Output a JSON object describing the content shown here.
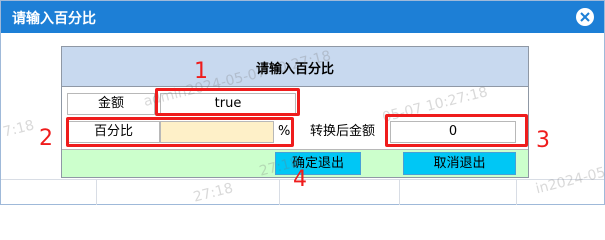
{
  "window": {
    "title": "请输入百分比"
  },
  "panel": {
    "title": "请输入百分比",
    "amount_label": "金额",
    "amount_value": "true",
    "percent_label": "百分比",
    "percent_value": "",
    "percent_unit": "%",
    "converted_label": "转换后金额",
    "converted_value": "0"
  },
  "buttons": {
    "confirm": "确定退出",
    "cancel": "取消退出"
  },
  "annotations": {
    "m1": "1",
    "m2": "2",
    "m3": "3",
    "m4": "4"
  },
  "watermark": {
    "w1": "admin2024-05-07 10:27:18",
    "w2": "7:18",
    "w3": "05-07 10:27:18",
    "w4": "27:18",
    "w5": "27:18",
    "w6": "in2024-05"
  },
  "colors": {
    "titlebar": "#1d7fd6",
    "panel_header": "#c8d9ef",
    "input_bg": "#fef0c8",
    "footer_bg": "#ccffcc",
    "button_bg": "#00c7f5",
    "annotation": "#ef1c1c"
  },
  "icons": {
    "close": "close-circle-icon"
  }
}
